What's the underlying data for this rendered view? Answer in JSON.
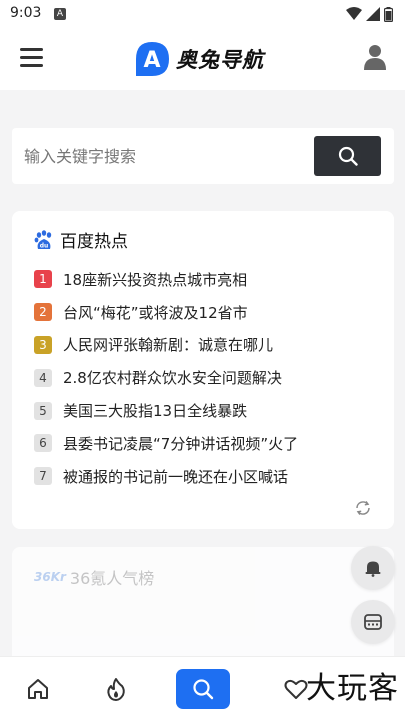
{
  "status_bar": {
    "time": "9:03",
    "notification_badge": "A",
    "icons": [
      "wifi-icon",
      "signal-icon",
      "battery-icon"
    ]
  },
  "header": {
    "app_name": "奥兔导航",
    "logo_letter": "A",
    "icons": {
      "menu": "menu-icon",
      "user": "user-icon"
    }
  },
  "search": {
    "placeholder": "输入关键字搜索",
    "value": ""
  },
  "hot_list": {
    "title": "百度热点",
    "logo_text": "du",
    "items": [
      {
        "rank": "1",
        "text": "18座新兴投资热点城市亮相",
        "color": "#e8424b"
      },
      {
        "rank": "2",
        "text": "台风“梅花”或将波及12省市",
        "color": "#e4733a"
      },
      {
        "rank": "3",
        "text": "人民网评张翰新剧：诚意在哪儿",
        "color": "#c9a227"
      },
      {
        "rank": "4",
        "text": "2.8亿农村群众饮水安全问题解决",
        "color": ""
      },
      {
        "rank": "5",
        "text": "美国三大股指13日全线暴跌",
        "color": ""
      },
      {
        "rank": "6",
        "text": "县委书记凌晨“7分钟讲话视频”火了",
        "color": ""
      },
      {
        "rank": "7",
        "text": "被通报的书记前一晚还在小区喊话",
        "color": ""
      }
    ],
    "refresh_icon": "refresh-icon"
  },
  "kr_card": {
    "logo_text": "36Kr",
    "title": "36氪人气榜"
  },
  "floating": [
    "notification-bell-icon",
    "calculator-icon"
  ],
  "bottom_nav": {
    "items": [
      "home-icon",
      "fire-icon",
      "search-icon",
      "heart-icon"
    ],
    "watermark": "大玩客"
  },
  "colors": {
    "brand_blue": "#1e6ff2",
    "search_button": "#2f3237",
    "background": "#f4f4f5"
  }
}
